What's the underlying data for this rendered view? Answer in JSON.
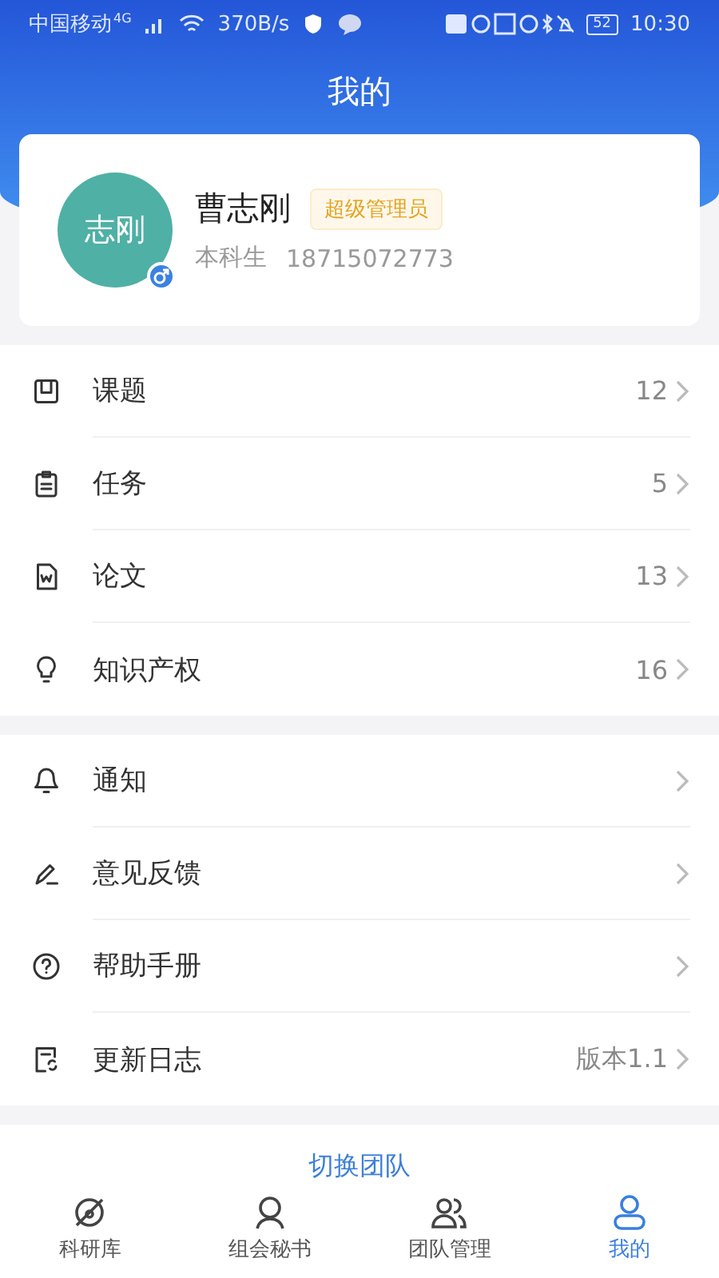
{
  "status_bar": {
    "carrier": "中国移动",
    "network": "4G",
    "speed": "370B/s",
    "battery": "52",
    "time": "10:30"
  },
  "title": "我的",
  "profile": {
    "avatar_text": "志刚",
    "name": "曹志刚",
    "role_badge": "超级管理员",
    "level": "本科生",
    "phone": "18715072773"
  },
  "menu_groups": [
    {
      "items": [
        {
          "label": "课题",
          "value": "12"
        },
        {
          "label": "任务",
          "value": "5"
        },
        {
          "label": "论文",
          "value": "13"
        },
        {
          "label": "知识产权",
          "value": "16"
        }
      ]
    },
    {
      "items": [
        {
          "label": "通知"
        },
        {
          "label": "意见反馈"
        },
        {
          "label": "帮助手册"
        },
        {
          "label": "更新日志",
          "value": "版本1.1"
        }
      ]
    }
  ],
  "switch_team": "切换团队",
  "tabs": [
    {
      "label": "科研库",
      "selected": false
    },
    {
      "label": "组会秘书",
      "selected": false
    },
    {
      "label": "团队管理",
      "selected": false
    },
    {
      "label": "我的",
      "selected": true
    }
  ]
}
